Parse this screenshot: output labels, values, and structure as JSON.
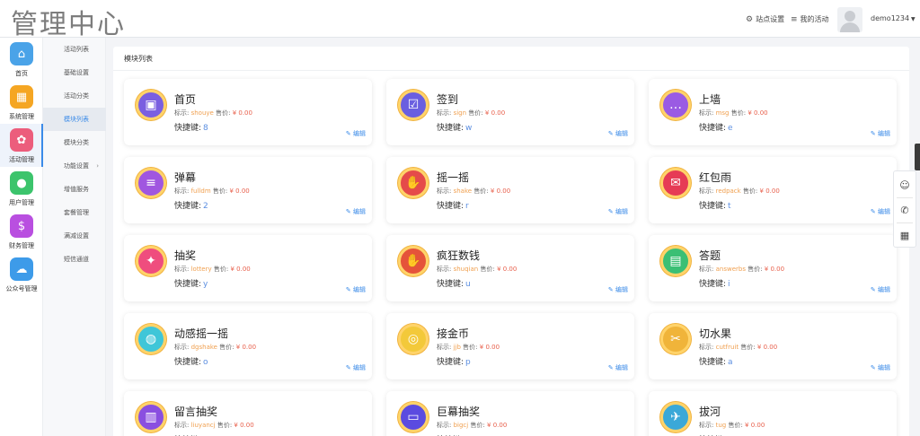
{
  "header": {
    "logo": "管理中心",
    "site_settings": "站点设置",
    "my_activity": "我的活动",
    "username": "demo1234"
  },
  "rail": [
    {
      "label": "首页",
      "icon": "home-icon",
      "color": "#4aa3e8",
      "glyph": "⌂"
    },
    {
      "label": "系统管理",
      "icon": "grid-icon",
      "color": "#f5a623",
      "glyph": "▦"
    },
    {
      "label": "活动管理",
      "icon": "gear-icon",
      "color": "#ec5d7c",
      "glyph": "✿"
    },
    {
      "label": "用户管理",
      "icon": "user-gear-icon",
      "color": "#3cc46c",
      "glyph": "●"
    },
    {
      "label": "财务管理",
      "icon": "money-icon",
      "color": "#b94fe0",
      "glyph": "$"
    },
    {
      "label": "公众号管理",
      "icon": "wechat-icon",
      "color": "#3d9be9",
      "glyph": "☁"
    }
  ],
  "submenu": [
    {
      "label": "活动列表"
    },
    {
      "label": "基础设置"
    },
    {
      "label": "活动分类"
    },
    {
      "label": "模块列表"
    },
    {
      "label": "模块分类"
    },
    {
      "label": "功能设置",
      "arrow": "›"
    },
    {
      "label": "增值服务"
    },
    {
      "label": "套餐管理"
    },
    {
      "label": "满减设置"
    },
    {
      "label": "短信通道"
    }
  ],
  "panel": {
    "title": "模块列表"
  },
  "labels": {
    "key": "标示:",
    "price": "售价:",
    "shortcut": "快捷键:",
    "edit": "编辑"
  },
  "cards": [
    {
      "name": "首页",
      "key": "shouye",
      "price": "¥ 0.00",
      "shortcut": "8",
      "icon": "calendar-icon",
      "color": "#7a5fe0",
      "glyph": "▣"
    },
    {
      "name": "签到",
      "key": "sign",
      "price": "¥ 0.00",
      "shortcut": "w",
      "icon": "checkin-icon",
      "color": "#6a5fe0",
      "glyph": "☑"
    },
    {
      "name": "上墙",
      "key": "msg",
      "price": "¥ 0.00",
      "shortcut": "e",
      "icon": "chat-icon",
      "color": "#9a5be3",
      "glyph": "…"
    },
    {
      "name": "弹幕",
      "key": "fulldm",
      "price": "¥ 0.00",
      "shortcut": "2",
      "icon": "danmu-icon",
      "color": "#a056e0",
      "glyph": "≡"
    },
    {
      "name": "摇一摇",
      "key": "shake",
      "price": "¥ 0.00",
      "shortcut": "r",
      "icon": "shake-icon",
      "color": "#e54a4a",
      "glyph": "✋"
    },
    {
      "name": "红包雨",
      "key": "redpack",
      "price": "¥ 0.00",
      "shortcut": "t",
      "icon": "redpack-icon",
      "color": "#e63b55",
      "glyph": "✉"
    },
    {
      "name": "抽奖",
      "key": "lottery",
      "price": "¥ 0.00",
      "shortcut": "y",
      "icon": "gift-icon",
      "color": "#ef4d7e",
      "glyph": "✦"
    },
    {
      "name": "疯狂数钱",
      "key": "shuqian",
      "price": "¥ 0.00",
      "shortcut": "u",
      "icon": "money-count-icon",
      "color": "#e5533a",
      "glyph": "✋"
    },
    {
      "name": "答题",
      "key": "answerbs",
      "price": "¥ 0.00",
      "shortcut": "i",
      "icon": "quiz-icon",
      "color": "#3bbf74",
      "glyph": "▤"
    },
    {
      "name": "动感摇一摇",
      "key": "dgshake",
      "price": "¥ 0.00",
      "shortcut": "o",
      "icon": "dynamic-shake-icon",
      "color": "#3fc6d8",
      "glyph": "◍"
    },
    {
      "name": "接金币",
      "key": "jjb",
      "price": "¥ 0.00",
      "shortcut": "p",
      "icon": "coin-icon",
      "color": "#f3c93a",
      "glyph": "◎"
    },
    {
      "name": "切水果",
      "key": "cutfruit",
      "price": "¥ 0.00",
      "shortcut": "a",
      "icon": "fruit-icon",
      "color": "#f0b43a",
      "glyph": "✂"
    },
    {
      "name": "留言抽奖",
      "key": "liuyancj",
      "price": "¥ 0.00",
      "shortcut": "",
      "icon": "message-lottery-icon",
      "color": "#8a4fe0",
      "glyph": "▥"
    },
    {
      "name": "巨幕抽奖",
      "key": "bigcj",
      "price": "¥ 0.00",
      "shortcut": "",
      "icon": "bigscreen-icon",
      "color": "#5b4be0",
      "glyph": "▭"
    },
    {
      "name": "拔河",
      "key": "tug",
      "price": "¥ 0.00",
      "shortcut": "",
      "icon": "tug-icon",
      "color": "#3aa8d8",
      "glyph": "✈"
    }
  ],
  "tools": [
    {
      "icon": "headset-icon",
      "glyph": "☺"
    },
    {
      "icon": "phone-icon",
      "glyph": "✆"
    },
    {
      "icon": "qrcode-icon",
      "glyph": "▦"
    }
  ]
}
